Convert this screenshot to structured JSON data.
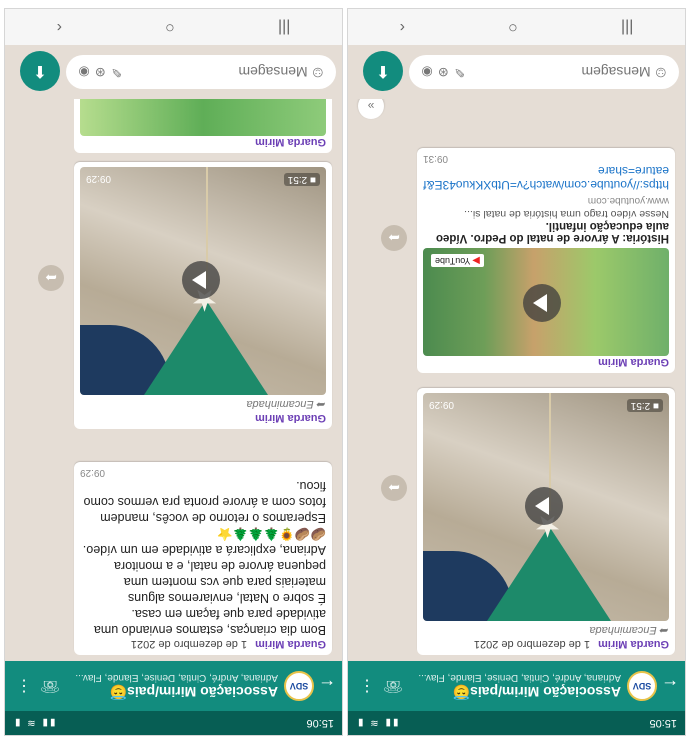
{
  "status": {
    "time_left": "15:06",
    "time_right": "15:05",
    "signal": "▮▮ ≋ ▮"
  },
  "header": {
    "avatar_text": "SDV",
    "title": "Associação Mirim/pais😇",
    "members": "Adriana, André, Cintia, Denise, Elande, Flav..."
  },
  "common": {
    "sender": "Guarda Mirim",
    "date": "1 de dezembro de 2021",
    "forwarded": "Encaminhada",
    "message_placeholder": "Mensagem",
    "send_icon": "mic-icon"
  },
  "left_chat": {
    "text_message": "Bom dia crianças, estamos enviando uma atividade para que façam em casa.\nÉ sobre o Natal, enviaremos alguns materiais para que vcs montem uma pequena árvore de natal, e a monitora Adriana, explicará a atividade em um vídeo. 🥔🥔🌻🌲🌲🌲⭐\nEsperamos o retorno de vocês, mandem fotos com a árvore pronta pra vermos como ficou.",
    "text_time": "09:29",
    "video_duration": "2:51",
    "video_time": "09:29"
  },
  "right_chat": {
    "video_duration": "2:51",
    "video_time": "09:29",
    "youtube_label": "YouTube",
    "link_title": "História: A árvore de natal do Pedro. Vídeo aula educação infantil.",
    "link_desc": "Nesse vídeo trago uma história de natal si...",
    "link_domain": "www.youtube.com",
    "link_url": "https://youtube.com/watch?v=UtbXKkuo43E&feature=share",
    "link_time": "09:31"
  },
  "nav": {
    "back": "‹",
    "home": "○",
    "recent": "|||"
  }
}
